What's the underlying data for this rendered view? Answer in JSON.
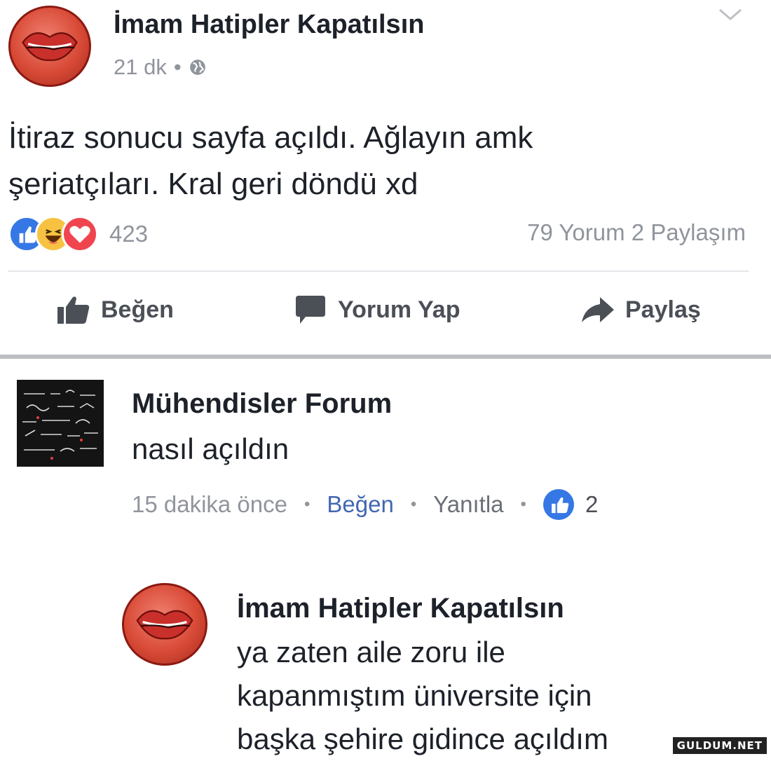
{
  "post": {
    "author": "İmam Hatipler Kapatılsın",
    "time": "21 dk",
    "meta_dot": "•",
    "text_line1": "İtiraz sonucu sayfa açıldı. Ağlayın amk",
    "text_line2": "şeriatçıları. Kral geri döndü xd",
    "reaction_count": "423",
    "comments_count": "79 Yorum",
    "shares_count": "2 Paylaşım",
    "actions": {
      "like": "Beğen",
      "comment": "Yorum Yap",
      "share": "Paylaş"
    }
  },
  "comment": {
    "author": "Mühendisler Forum",
    "text": "nasıl açıldın",
    "time": "15 dakika önce",
    "like": "Beğen",
    "reply": "Yanıtla",
    "dot": "•",
    "like_count": "2"
  },
  "reply": {
    "author": "İmam Hatipler Kapatılsın",
    "line1": "ya zaten aile zoru ile",
    "line2": "kapanmıştım üniversite için",
    "line3": "başka şehire gidince açıldım"
  },
  "watermark": "GULDUM.NET",
  "colors": {
    "facebook_blue": "#4267b2",
    "like_reaction": "#3578e5",
    "love_reaction": "#f0454f",
    "haha_reaction": "#f7c242",
    "meta_gray": "#90949c"
  }
}
